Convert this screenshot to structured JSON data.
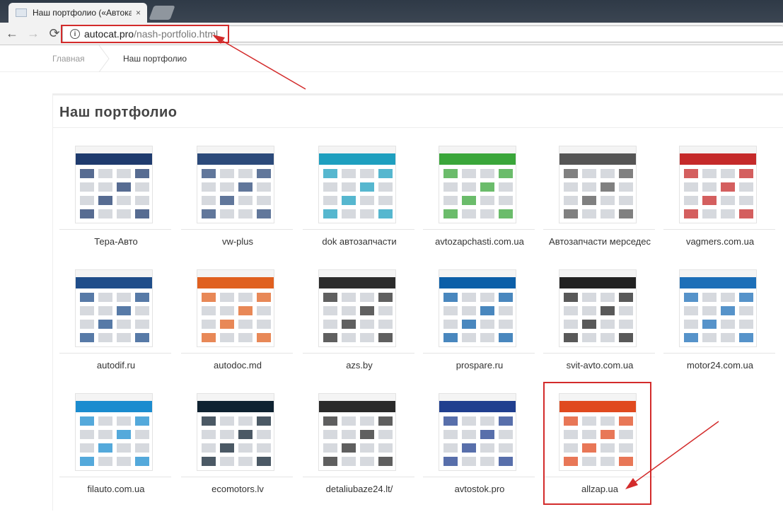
{
  "browser": {
    "tab_title": "Наш портфолио («Автокат",
    "tab_close": "×",
    "url_host": "autocat.pro",
    "url_path": "/nash-portfolio.html",
    "back_icon": "←",
    "forward_icon": "→",
    "reload_icon": "⟳",
    "info_icon": "i"
  },
  "breadcrumb": {
    "home": "Главная",
    "current": "Наш портфолио"
  },
  "page": {
    "title": "Наш портфолио"
  },
  "portfolio": [
    {
      "label": "Тера-Авто",
      "accent": "#1f3b6e"
    },
    {
      "label": "vw-plus",
      "accent": "#2c4a7a"
    },
    {
      "label": "dok автозапчасти",
      "accent": "#1e9fbf"
    },
    {
      "label": "avtozapchasti.com.ua",
      "accent": "#3aa63a"
    },
    {
      "label": "Автозапчасти мерседес",
      "accent": "#555555"
    },
    {
      "label": "vagmers.com.ua",
      "accent": "#c52a2a"
    },
    {
      "label": "autodif.ru",
      "accent": "#1f4d8a"
    },
    {
      "label": "autodoc.md",
      "accent": "#e0601f"
    },
    {
      "label": "azs.by",
      "accent": "#2b2b2b"
    },
    {
      "label": "prospare.ru",
      "accent": "#0c5fa8"
    },
    {
      "label": "svit-avto.com.ua",
      "accent": "#222222"
    },
    {
      "label": "motor24.com.ua",
      "accent": "#1d6fb8"
    },
    {
      "label": "filauto.com.ua",
      "accent": "#1b8ccf"
    },
    {
      "label": "ecomotors.lv",
      "accent": "#0f2231"
    },
    {
      "label": "detaliubaze24.lt/",
      "accent": "#2a2a2a"
    },
    {
      "label": "avtostok.pro",
      "accent": "#203f8f"
    },
    {
      "label": "allzap.ua",
      "accent": "#e04a1f"
    }
  ]
}
